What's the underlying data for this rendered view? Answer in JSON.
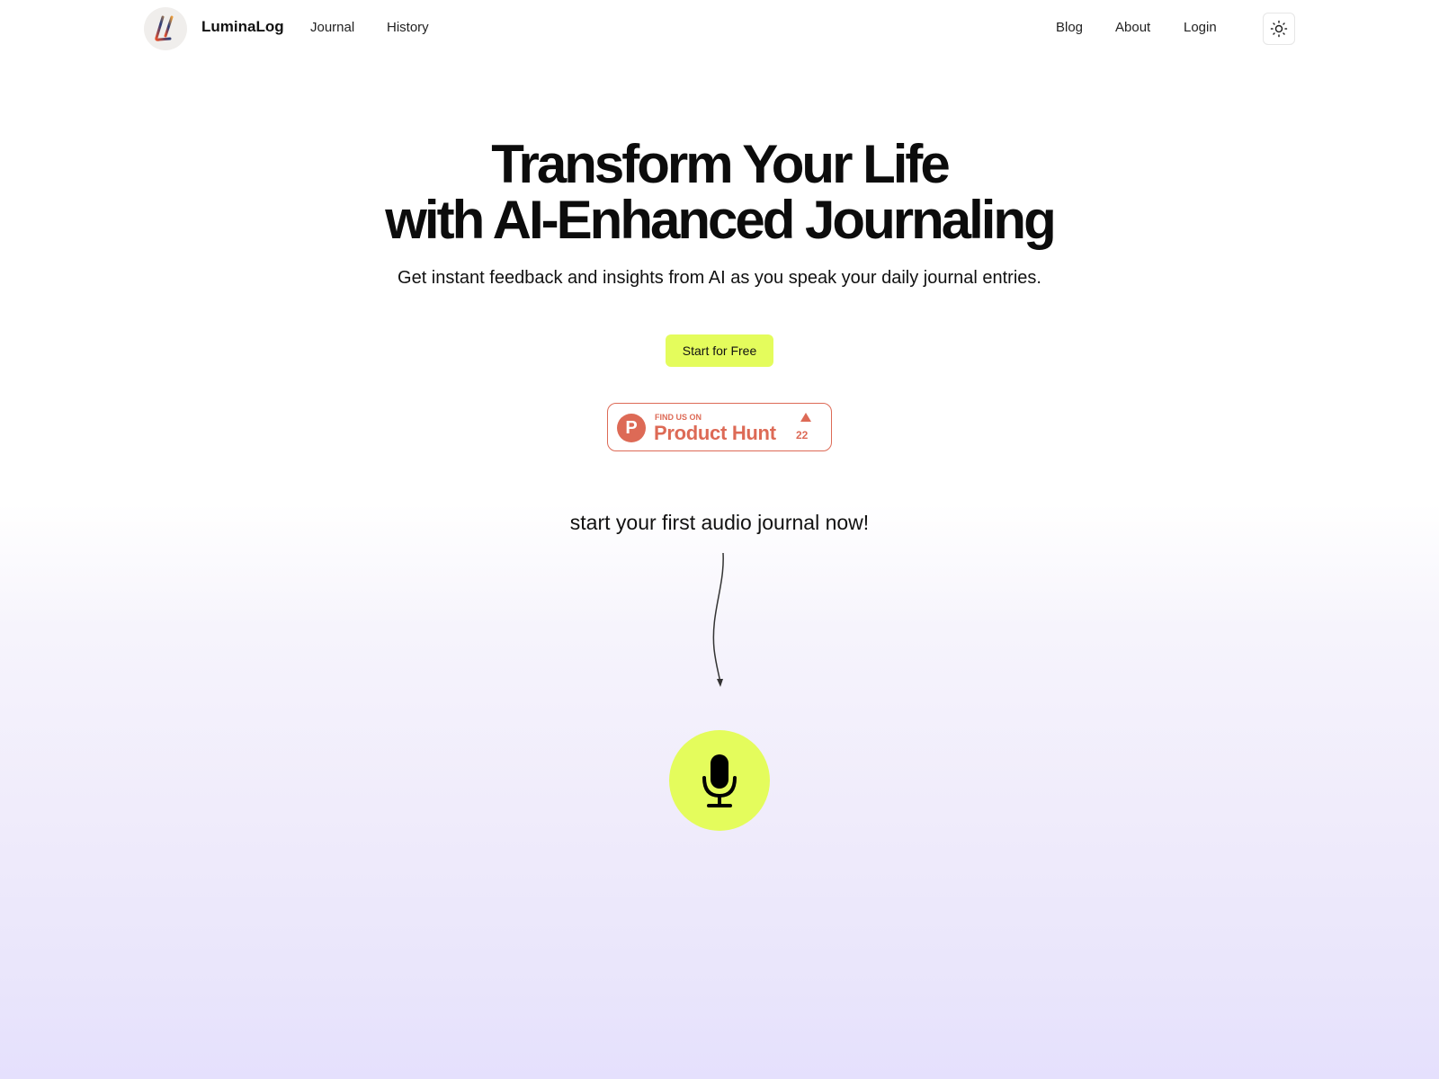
{
  "nav": {
    "brand": "LuminaLog",
    "logo_icon": "luminalog-logo-icon",
    "left_links": [
      {
        "label": "Journal"
      },
      {
        "label": "History"
      }
    ],
    "right_links": [
      {
        "label": "Blog"
      },
      {
        "label": "About"
      },
      {
        "label": "Login"
      }
    ],
    "theme_toggle_icon": "sun-icon"
  },
  "hero": {
    "title_line1": "Transform Your Life",
    "title_line2": "with AI-Enhanced Journaling",
    "subtitle": "Get instant feedback and insights from AI as you speak your daily journal entries.",
    "cta_label": "Start for Free",
    "accent_color": "#e4fc5c"
  },
  "product_hunt": {
    "find_label": "FIND US ON",
    "name": "Product Hunt",
    "logo_letter": "P",
    "upvotes": "22",
    "color": "#dd6a56"
  },
  "audio": {
    "prompt": "start your first audio journal now!",
    "arrow_icon": "curved-arrow-down-icon",
    "mic_icon": "microphone-icon"
  }
}
